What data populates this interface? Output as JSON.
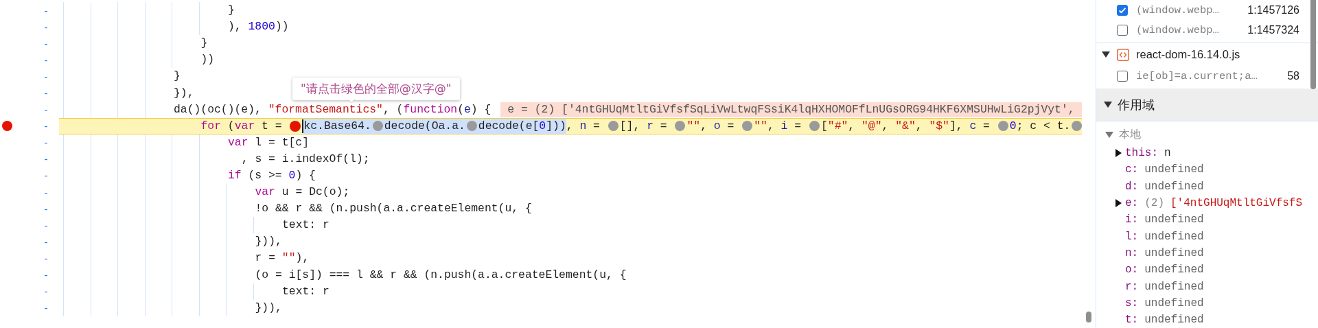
{
  "editor": {
    "lines": [
      {
        "marker": "-",
        "breakpoint": false,
        "paused": false,
        "segments": [
          {
            "kind": "code",
            "selected": false,
            "parts": [
              "                        }"
            ]
          }
        ]
      },
      {
        "marker": "-",
        "breakpoint": false,
        "paused": false,
        "segments": [
          {
            "kind": "code",
            "selected": false,
            "parts": [
              "                        ), ",
              {
                "text": "1800",
                "kind": "number"
              },
              "))"
            ]
          }
        ]
      },
      {
        "marker": "-",
        "breakpoint": false,
        "paused": false,
        "segments": [
          {
            "kind": "code",
            "selected": false,
            "parts": [
              "                    }"
            ]
          }
        ]
      },
      {
        "marker": "-",
        "breakpoint": false,
        "paused": false,
        "segments": [
          {
            "kind": "code",
            "selected": false,
            "parts": [
              "                    ))"
            ]
          }
        ]
      },
      {
        "marker": "-",
        "breakpoint": false,
        "paused": false,
        "segments": [
          {
            "kind": "code",
            "selected": false,
            "parts": [
              "                }"
            ]
          }
        ]
      },
      {
        "marker": "-",
        "breakpoint": false,
        "paused": false,
        "segments": [
          {
            "kind": "code",
            "selected": false,
            "parts": [
              "                }),"
            ]
          }
        ]
      },
      {
        "marker": "-",
        "breakpoint": false,
        "paused": false,
        "segments": [
          {
            "kind": "code",
            "selected": false,
            "parts": [
              "                da()(oc()(e), ",
              {
                "text": "\"formatSemantics\"",
                "kind": "string"
              },
              ", (",
              {
                "text": "function",
                "kind": "keyword"
              },
              "(",
              {
                "text": "e",
                "kind": "def"
              },
              ") {"
            ]
          },
          {
            "kind": "inline-value",
            "text": "e = (2) ['4ntGHUqMtltGiVfsfSqLiVwLtwqFSsiK4lqHXHOMOFfLnUGsORG94HKF6XMSUHwLiG2pjVyt',"
          }
        ]
      },
      {
        "marker": "-",
        "breakpoint": true,
        "paused": true,
        "segments": [
          {
            "kind": "code",
            "selected": false,
            "parts": [
              {
                "text": "                    for",
                "kind": "keyword"
              },
              " (",
              {
                "text": "var",
                "kind": "keyword"
              },
              " t = "
            ]
          },
          {
            "kind": "breakpoint-dot",
            "selected": false
          },
          {
            "kind": "cursor"
          },
          {
            "kind": "code",
            "selected": true,
            "parts": [
              "kc.Base64."
            ]
          },
          {
            "kind": "value-dot",
            "selected": true
          },
          {
            "kind": "code",
            "selected": true,
            "parts": [
              "decode(Oa.a."
            ]
          },
          {
            "kind": "value-dot",
            "selected": true
          },
          {
            "kind": "code",
            "selected": true,
            "parts": [
              "decode(e[",
              {
                "text": "0",
                "kind": "number"
              },
              "]))"
            ]
          },
          {
            "kind": "code",
            "selected": false,
            "parts": [
              ", ",
              {
                "text": "n",
                "kind": "def"
              },
              " = "
            ]
          },
          {
            "kind": "value-dot",
            "selected": false
          },
          {
            "kind": "code",
            "selected": false,
            "parts": [
              "[], ",
              {
                "text": "r",
                "kind": "def"
              },
              " = "
            ]
          },
          {
            "kind": "value-dot",
            "selected": false
          },
          {
            "kind": "code",
            "selected": false,
            "parts": [
              {
                "text": "\"\"",
                "kind": "string"
              },
              ", ",
              {
                "text": "o",
                "kind": "def"
              },
              " = "
            ]
          },
          {
            "kind": "value-dot",
            "selected": false
          },
          {
            "kind": "code",
            "selected": false,
            "parts": [
              {
                "text": "\"\"",
                "kind": "string"
              },
              ", ",
              {
                "text": "i",
                "kind": "def"
              },
              " = "
            ]
          },
          {
            "kind": "value-dot",
            "selected": false
          },
          {
            "kind": "code",
            "selected": false,
            "parts": [
              "[",
              {
                "text": "\"#\"",
                "kind": "string"
              },
              ", ",
              {
                "text": "\"@\"",
                "kind": "string"
              },
              ", ",
              {
                "text": "\"&\"",
                "kind": "string"
              },
              ", ",
              {
                "text": "\"$\"",
                "kind": "string"
              },
              "], ",
              {
                "text": "c",
                "kind": "def"
              },
              " = "
            ]
          },
          {
            "kind": "value-dot",
            "selected": false
          },
          {
            "kind": "code",
            "selected": false,
            "parts": [
              {
                "text": "0",
                "kind": "number"
              },
              "; c < t."
            ]
          },
          {
            "kind": "value-dot",
            "selected": false
          }
        ]
      },
      {
        "marker": "-",
        "breakpoint": false,
        "paused": false,
        "segments": [
          {
            "kind": "code",
            "selected": false,
            "parts": [
              {
                "text": "                        var",
                "kind": "keyword"
              },
              " l = t[c]"
            ]
          }
        ]
      },
      {
        "marker": "-",
        "breakpoint": false,
        "paused": false,
        "segments": [
          {
            "kind": "code",
            "selected": false,
            "parts": [
              "                          , s = i.indexOf(l);"
            ]
          }
        ]
      },
      {
        "marker": "-",
        "breakpoint": false,
        "paused": false,
        "segments": [
          {
            "kind": "code",
            "selected": false,
            "parts": [
              {
                "text": "                        if",
                "kind": "keyword"
              },
              " (s >= ",
              {
                "text": "0",
                "kind": "number"
              },
              ") {"
            ]
          }
        ]
      },
      {
        "marker": "-",
        "breakpoint": false,
        "paused": false,
        "segments": [
          {
            "kind": "code",
            "selected": false,
            "parts": [
              {
                "text": "                            var",
                "kind": "keyword"
              },
              " u = Dc(o);"
            ]
          }
        ]
      },
      {
        "marker": "-",
        "breakpoint": false,
        "paused": false,
        "segments": [
          {
            "kind": "code",
            "selected": false,
            "parts": [
              "                            !o && r && (n.push(a.a.createElement(u, {"
            ]
          }
        ]
      },
      {
        "marker": "-",
        "breakpoint": false,
        "paused": false,
        "segments": [
          {
            "kind": "code",
            "selected": false,
            "parts": [
              "                                text: r"
            ]
          }
        ]
      },
      {
        "marker": "-",
        "breakpoint": false,
        "paused": false,
        "segments": [
          {
            "kind": "code",
            "selected": false,
            "parts": [
              "                            })),"
            ]
          }
        ]
      },
      {
        "marker": "-",
        "breakpoint": false,
        "paused": false,
        "segments": [
          {
            "kind": "code",
            "selected": false,
            "parts": [
              "                            r = ",
              {
                "text": "\"\"",
                "kind": "string"
              },
              "),"
            ]
          }
        ]
      },
      {
        "marker": "-",
        "breakpoint": false,
        "paused": false,
        "segments": [
          {
            "kind": "code",
            "selected": false,
            "parts": [
              "                            (o = i[s]) === l && r && (n.push(a.a.createElement(u, {"
            ]
          }
        ]
      },
      {
        "marker": "-",
        "breakpoint": false,
        "paused": false,
        "segments": [
          {
            "kind": "code",
            "selected": false,
            "parts": [
              "                                text: r"
            ]
          }
        ]
      },
      {
        "marker": "-",
        "breakpoint": false,
        "paused": false,
        "segments": [
          {
            "kind": "code",
            "selected": false,
            "parts": [
              "                            })),"
            ]
          }
        ]
      }
    ],
    "tooltip": {
      "text": "\"请点击绿色的全部@汉字@\""
    }
  },
  "breakpoints": [
    {
      "kind": "entry",
      "checked": true,
      "code": "(window.webp…",
      "location": "1:1457126"
    },
    {
      "kind": "entry",
      "checked": false,
      "code": "(window.webp…",
      "location": "1:1457324"
    },
    {
      "kind": "file",
      "expanded": true,
      "name": "react-dom-16.14.0.js"
    },
    {
      "kind": "entry",
      "checked": false,
      "code": "ie[ob]=a.current;a…",
      "location": "58"
    }
  ],
  "scope": {
    "title": "作用域",
    "expanded": true,
    "groups": [
      {
        "title": "本地",
        "expanded": true,
        "variables": [
          {
            "name": "this:",
            "kind": "object",
            "expandable": true,
            "value": "n"
          },
          {
            "name": "c:",
            "kind": "undefined",
            "expandable": false,
            "value": "undefined"
          },
          {
            "name": "d:",
            "kind": "undefined",
            "expandable": false,
            "value": "undefined"
          },
          {
            "name": "e:",
            "kind": "array",
            "expandable": true,
            "length": "(2)",
            "value": "['4ntGHUqMtltGiVfsfS"
          },
          {
            "name": "i:",
            "kind": "undefined",
            "expandable": false,
            "value": "undefined"
          },
          {
            "name": "l:",
            "kind": "undefined",
            "expandable": false,
            "value": "undefined"
          },
          {
            "name": "n:",
            "kind": "undefined",
            "expandable": false,
            "value": "undefined"
          },
          {
            "name": "o:",
            "kind": "undefined",
            "expandable": false,
            "value": "undefined"
          },
          {
            "name": "r:",
            "kind": "undefined",
            "expandable": false,
            "value": "undefined"
          },
          {
            "name": "s:",
            "kind": "undefined",
            "expandable": false,
            "value": "undefined"
          },
          {
            "name": "t:",
            "kind": "undefined",
            "expandable": false,
            "value": "undefined"
          }
        ]
      }
    ]
  }
}
